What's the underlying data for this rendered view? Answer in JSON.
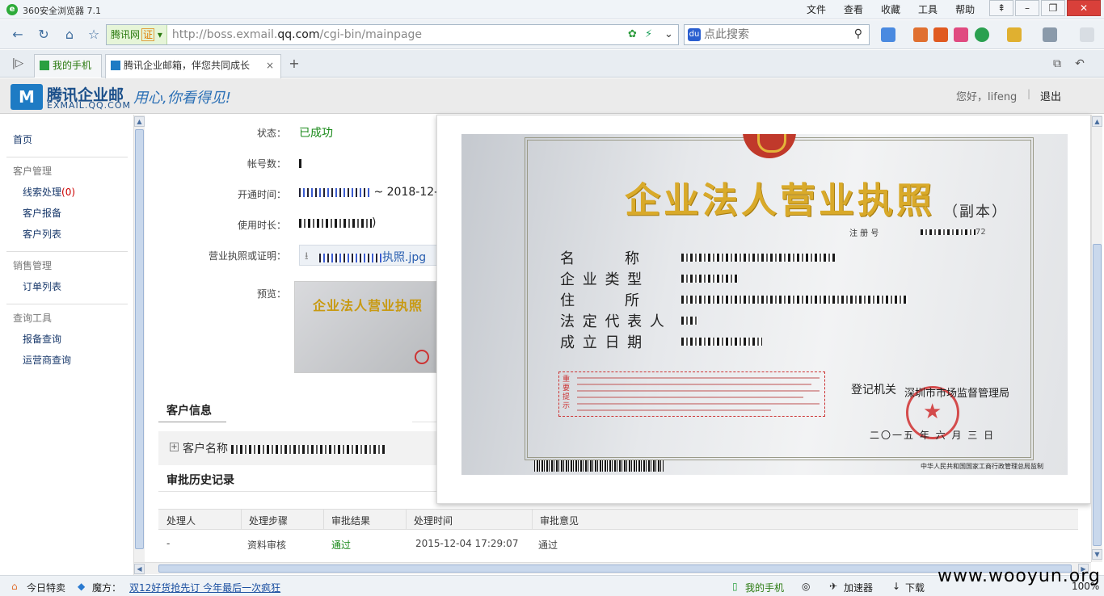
{
  "browser": {
    "title": "360安全浏览器 7.1",
    "menus": [
      "文件",
      "查看",
      "收藏",
      "工具",
      "帮助"
    ],
    "site_name": "腾讯网",
    "cert_badge": "证",
    "url_prefix": "http://boss.exmail.",
    "url_domain": "qq.com",
    "url_path": "/cgi-bin/mainpage",
    "search_placeholder": "点此搜索",
    "tabs": [
      {
        "label": "我的手机"
      },
      {
        "label": "腾讯企业邮箱，伴您共同成长"
      }
    ]
  },
  "header": {
    "brand": "腾讯企业邮",
    "domain": "EXMAIL.QQ.COM",
    "slogan": "用心,你看得见!",
    "greeting": "您好，",
    "username": "lifeng",
    "logout": "退出"
  },
  "sidebar": {
    "home": "首页",
    "groups": [
      {
        "title": "客户管理",
        "items": [
          {
            "label": "线索处理",
            "count": "(0)"
          },
          {
            "label": "客户报备"
          },
          {
            "label": "客户列表"
          }
        ]
      },
      {
        "title": "销售管理",
        "items": [
          {
            "label": "订单列表"
          }
        ]
      },
      {
        "title": "查询工具",
        "items": [
          {
            "label": "报备查询"
          },
          {
            "label": "运营商查询"
          }
        ]
      }
    ]
  },
  "detail": {
    "status_label": "状态：",
    "status_value": "已成功",
    "accounts_label": "帐号数：",
    "open_time_label": "开通时间：",
    "open_time_suffix": "~ 2018-12-",
    "duration_label": "使用时长：",
    "duration_suffix": ")",
    "license_label": "营业执照或证明：",
    "license_file_suffix": "执照.jpg",
    "preview_label": "预览：",
    "thumb_title": "企业法人营业执照"
  },
  "customer": {
    "section_title": "客户信息",
    "name_label": "客户名称"
  },
  "history": {
    "section_title": "审批历史记录",
    "columns": [
      "处理人",
      "处理步骤",
      "审批结果",
      "处理时间",
      "审批意见"
    ],
    "rows": [
      {
        "handler": "-",
        "step": "资料审核",
        "result": "通过",
        "time": "2015-12-04 17:29:07",
        "opinion": "通过"
      }
    ]
  },
  "license": {
    "title": "企业法人营业执照",
    "copy": "（副本）",
    "reg_label": "注 册 号",
    "reg_suffix": "72",
    "fields": [
      "名　　　称",
      "企 业 类 型",
      "住　　　所",
      "法 定 代 表 人",
      "成 立 日 期"
    ],
    "notes_head": "重要提示",
    "authority_label": "登记机关",
    "authority_value": "深圳市市场监督管理局",
    "date": "二〇一五 年 六 月 三 日",
    "footer": "中华人民共和国国家工商行政管理总局监制"
  },
  "statusbar": {
    "today": "今日特卖",
    "magic": "魔方：",
    "promo": "双12好货抢先订 今年最后一次疯狂",
    "phone": "我的手机",
    "accelerator": "加速器",
    "download": "下载",
    "zoom": "100%",
    "watermark": "www.wooyun.org"
  },
  "colors": {
    "accent": "#1e7bc4",
    "success": "#1a8a1a",
    "license_gold": "#d9aa2a",
    "seal_red": "#d03030"
  }
}
